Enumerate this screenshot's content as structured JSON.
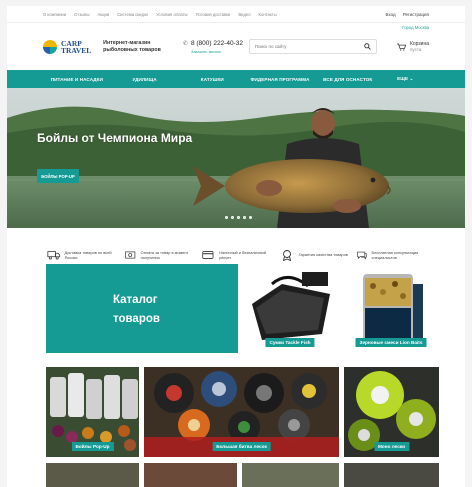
{
  "topbar": {
    "links": [
      "О компании",
      "Отзывы",
      "Акции",
      "Система скидок",
      "Условия оплаты",
      "Условия доставки",
      "Видео",
      "Контакты"
    ],
    "login": "Вход",
    "register": "Регистрация"
  },
  "header": {
    "logo_line1": "CARP",
    "logo_line2": "TRAVEL",
    "tagline": "Интернет-магазин рыболовных товаров",
    "phone": "8 (800) 222-40-32",
    "callback": "Заказать звонок",
    "search_placeholder": "Поиск по сайту",
    "cart_label": "Корзина",
    "cart_sum": "пуста",
    "city": "Город Москва"
  },
  "nav": {
    "items": [
      "ПИТАНИЕ И НАСАДКИ",
      "УДИЛИЩА",
      "КАТУШКИ",
      "ФИДЕРНАЯ ПРОГРАММА",
      "ВСЕ ДЛЯ ОСНАСТОК",
      "ЕЩЕ"
    ]
  },
  "hero": {
    "title": "Бойлы от Чемпиона Мира",
    "button": "БОЙЛЫ POP-UP",
    "slides": 5,
    "active_slide": 4
  },
  "features": [
    {
      "icon": "truck-icon",
      "text": "Доставка товаров по всей России"
    },
    {
      "icon": "cash-on-delivery-icon",
      "text": "Оплата за товар в момент получения"
    },
    {
      "icon": "card-payment-icon",
      "text": "Наличный и безналичный расчет"
    },
    {
      "icon": "quality-badge-icon",
      "text": "Гарантия качества товаров"
    },
    {
      "icon": "chat-icon",
      "text": "Бесплатная консультация специалистов"
    }
  ],
  "catalog": {
    "title": "Каталог товаров",
    "tiles": [
      {
        "label": "Сумки Tackle Fish"
      },
      {
        "label": "Зерновые смеси Lion Baits"
      },
      {
        "label": "Бойлы Pop-Up"
      },
      {
        "label": "Большая битва лесок"
      },
      {
        "label": "Моно лески"
      }
    ]
  },
  "colors": {
    "accent": "#159a94",
    "brand_blue": "#1f4f8f",
    "brand_yellow": "#f2b705"
  }
}
